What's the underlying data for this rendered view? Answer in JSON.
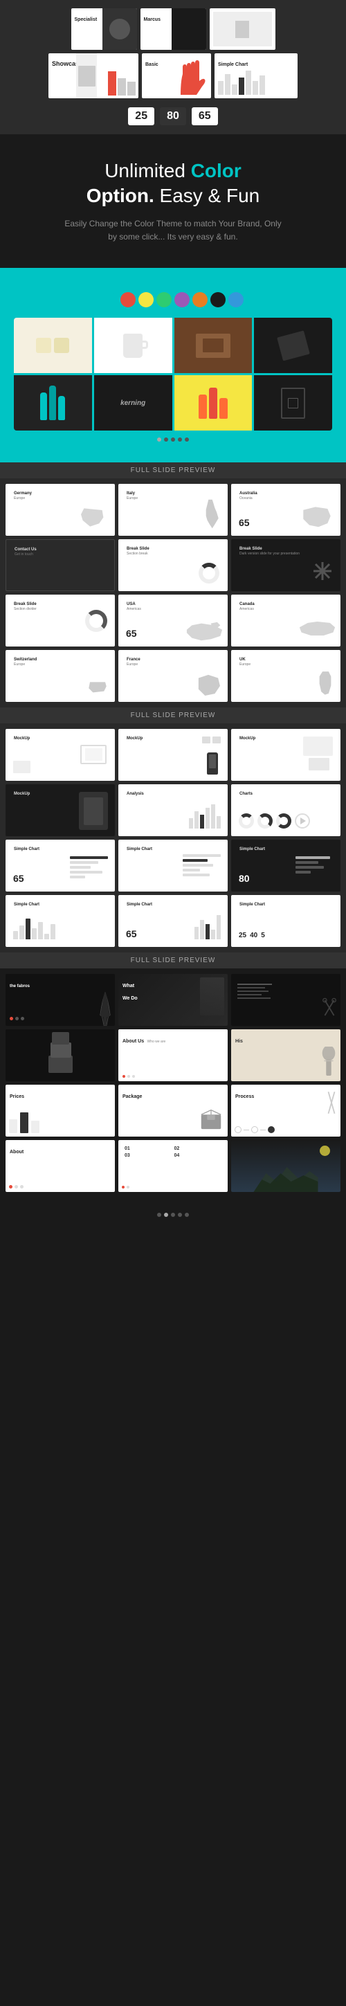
{
  "hero": {
    "title": "Unlimited Color Option. Easy & Fun",
    "title_bold": "Color",
    "title_bold2": "Option.",
    "subtitle": "Easily Change the Color Theme to match Your Brand, Only by some click... Its very easy & fun.",
    "slides": {
      "row1": [
        {
          "label": "Specialist",
          "sub": ""
        },
        {
          "label": "Marcus",
          "sub": ""
        },
        {
          "label": "Showcase",
          "sub": ""
        }
      ],
      "row2": [
        {
          "label": "Basic",
          "sub": ""
        },
        {
          "label": "Simple Chart",
          "sub": ""
        }
      ]
    }
  },
  "section_labels": {
    "full_slide_preview_1": "Full Slide Preview",
    "full_slide_preview_2": "Full Slide Preview",
    "full_slide_preview_3": "Full Slide Preview"
  },
  "swatches": {
    "colors": [
      "#00c4c4",
      "#e74c3c",
      "#f5e642",
      "#2ecc71",
      "#9b59b6",
      "#e67e22",
      "#1a1a1a",
      "#3498db"
    ]
  },
  "slides_group1": [
    {
      "title": "Germany",
      "num": "",
      "type": "map",
      "dark": false
    },
    {
      "title": "Italy",
      "num": "",
      "type": "map",
      "dark": false
    },
    {
      "title": "Australia",
      "num": "",
      "type": "map",
      "dark": false
    },
    {
      "title": "Contact Us",
      "num": "",
      "type": "break",
      "dark": true
    },
    {
      "title": "Break Slide",
      "num": "",
      "type": "break",
      "dark": false
    },
    {
      "title": "Break Slide",
      "num": "",
      "type": "break-dark",
      "dark": true
    },
    {
      "title": "Break Slide",
      "num": "",
      "type": "break",
      "dark": false
    },
    {
      "title": "USA",
      "num": "65",
      "type": "map",
      "dark": false
    },
    {
      "title": "Canada",
      "num": "",
      "type": "map",
      "dark": false
    },
    {
      "title": "Switzerland",
      "num": "",
      "type": "map",
      "dark": false
    },
    {
      "title": "France",
      "num": "",
      "type": "map",
      "dark": false
    },
    {
      "title": "UK",
      "num": "",
      "type": "map",
      "dark": false
    }
  ],
  "slides_group2": [
    {
      "title": "MockUp",
      "num": "",
      "type": "mockup",
      "dark": false
    },
    {
      "title": "MockUp",
      "num": "",
      "type": "mockup-phone",
      "dark": false
    },
    {
      "title": "MockUp",
      "num": "",
      "type": "mockup",
      "dark": false
    },
    {
      "title": "MockUp",
      "num": "",
      "type": "mockup-dark",
      "dark": true
    },
    {
      "title": "Analysis",
      "num": "",
      "type": "chart-bar",
      "dark": false
    },
    {
      "title": "",
      "num": "",
      "type": "donut",
      "dark": false
    },
    {
      "title": "Simple Chart",
      "num": "65",
      "type": "hbar",
      "dark": false
    },
    {
      "title": "Simple Chart",
      "num": "",
      "type": "hbar",
      "dark": false
    },
    {
      "title": "Simple Chart",
      "num": "80",
      "type": "hbar-dark",
      "dark": true
    },
    {
      "title": "Simple Chart",
      "num": "",
      "type": "hbar",
      "dark": false
    },
    {
      "title": "Simple Chart",
      "num": "65",
      "type": "vbar",
      "dark": false
    },
    {
      "title": "",
      "num": "25 40 5",
      "type": "multi",
      "dark": false
    }
  ],
  "slides_group3": [
    {
      "title": "the fabros",
      "num": "",
      "type": "eiffel",
      "dark": true
    },
    {
      "title": "What We Do",
      "num": "",
      "type": "what",
      "dark": true
    },
    {
      "title": "",
      "num": "",
      "type": "dark-text",
      "dark": true
    },
    {
      "title": "",
      "num": "",
      "type": "boxes",
      "dark": false
    },
    {
      "title": "About Us",
      "num": "",
      "type": "about",
      "dark": false
    },
    {
      "title": "His",
      "num": "",
      "type": "his",
      "dark": false
    },
    {
      "title": "Prices",
      "num": "",
      "type": "prices",
      "dark": false
    },
    {
      "title": "Package",
      "num": "",
      "type": "package",
      "dark": false
    },
    {
      "title": "Process",
      "num": "",
      "type": "process",
      "dark": false
    },
    {
      "title": "About",
      "num": "",
      "type": "about2",
      "dark": false
    },
    {
      "title": "",
      "num": "01 02 03 04",
      "type": "numbers",
      "dark": false
    },
    {
      "title": "",
      "num": "",
      "type": "mountain",
      "dark": true
    }
  ],
  "nav": {
    "dots": 5
  }
}
